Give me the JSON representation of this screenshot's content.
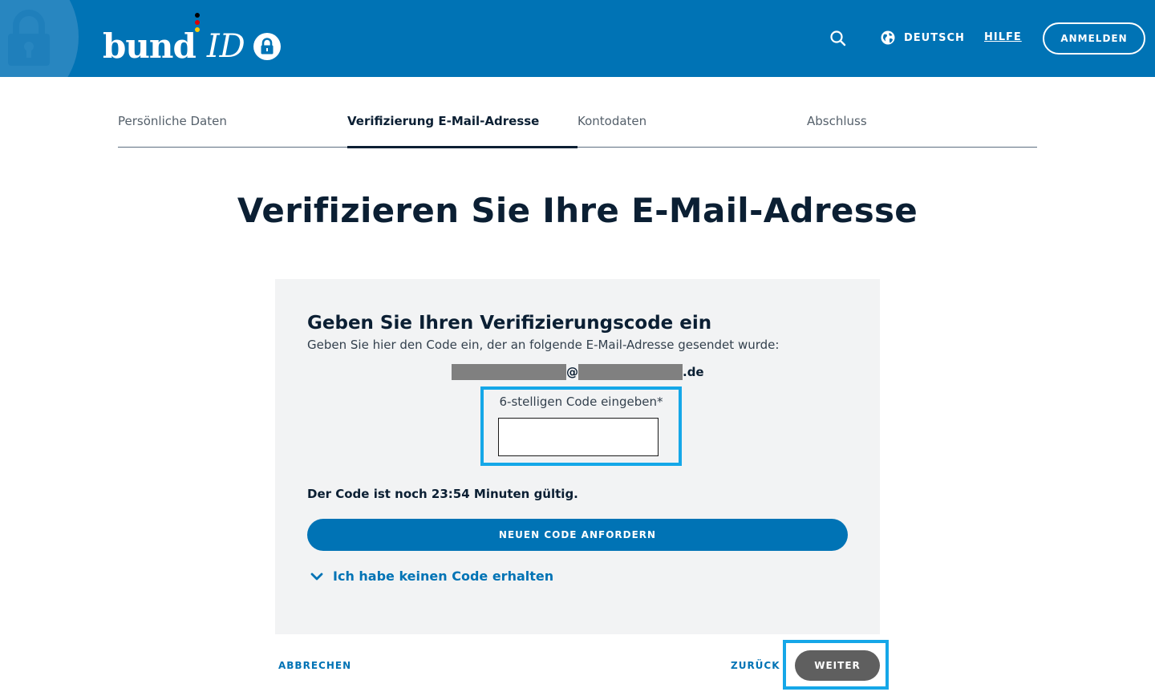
{
  "header": {
    "logo": {
      "bund": "bund",
      "id": "ID"
    },
    "language_label": "DEUTSCH",
    "help_label": "HILFE",
    "login_label": "ANMELDEN",
    "icons": [
      "search-icon",
      "globe-icon",
      "lock-icon"
    ]
  },
  "stepper": {
    "steps": [
      {
        "label": "Persönliche Daten",
        "active": false
      },
      {
        "label": "Verifizierung E-Mail-Adresse",
        "active": true
      },
      {
        "label": "Kontodaten",
        "active": false
      },
      {
        "label": "Abschluss",
        "active": false
      }
    ]
  },
  "page_title": "Verifizieren Sie Ihre E-Mail-Adresse",
  "card": {
    "title": "Geben Sie Ihren Verifizierungscode ein",
    "description": "Geben Sie hier den Code ein, der an folgende E-Mail-Adresse gesendet wurde:",
    "email_at": "@",
    "email_suffix": ".de",
    "code_label": "6-stelligen Code eingeben*",
    "code_value": "",
    "validity_text": "Der Code ist noch 23:54 Minuten gültig.",
    "new_code_label": "NEUEN CODE ANFORDERN",
    "no_code_label": "Ich habe keinen Code erhalten"
  },
  "actions": {
    "cancel_label": "ABBRECHEN",
    "back_label": "ZURÜCK",
    "next_label": "WEITER"
  },
  "colors": {
    "header_blue": "#0073b5",
    "highlight": "#15a7e8",
    "card_bg": "#f2f3f4",
    "disabled_button": "#5f5f5f",
    "text_dark": "#0b1f33"
  }
}
